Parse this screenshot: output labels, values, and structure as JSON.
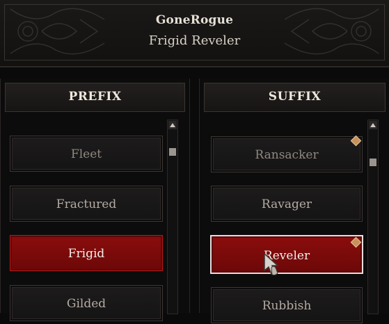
{
  "header": {
    "player_name": "GoneRogue",
    "title_name": "Frigid Reveler"
  },
  "prefix": {
    "heading": "PREFIX",
    "items": [
      "Fleet",
      "Fractured",
      "Frigid",
      "Gilded"
    ],
    "selected": "Frigid"
  },
  "suffix": {
    "heading": "SUFFIX",
    "items": [
      "Ransacker",
      "Ravager",
      "Reveler",
      "Rubbish"
    ],
    "selected": "Reveler"
  },
  "colors": {
    "selected_bg": "#8b0d0d",
    "new_marker": "#c8925a"
  },
  "icons": [
    "scroll-up-arrow-icon",
    "new-item-diamond-icon",
    "hand-cursor-icon"
  ]
}
